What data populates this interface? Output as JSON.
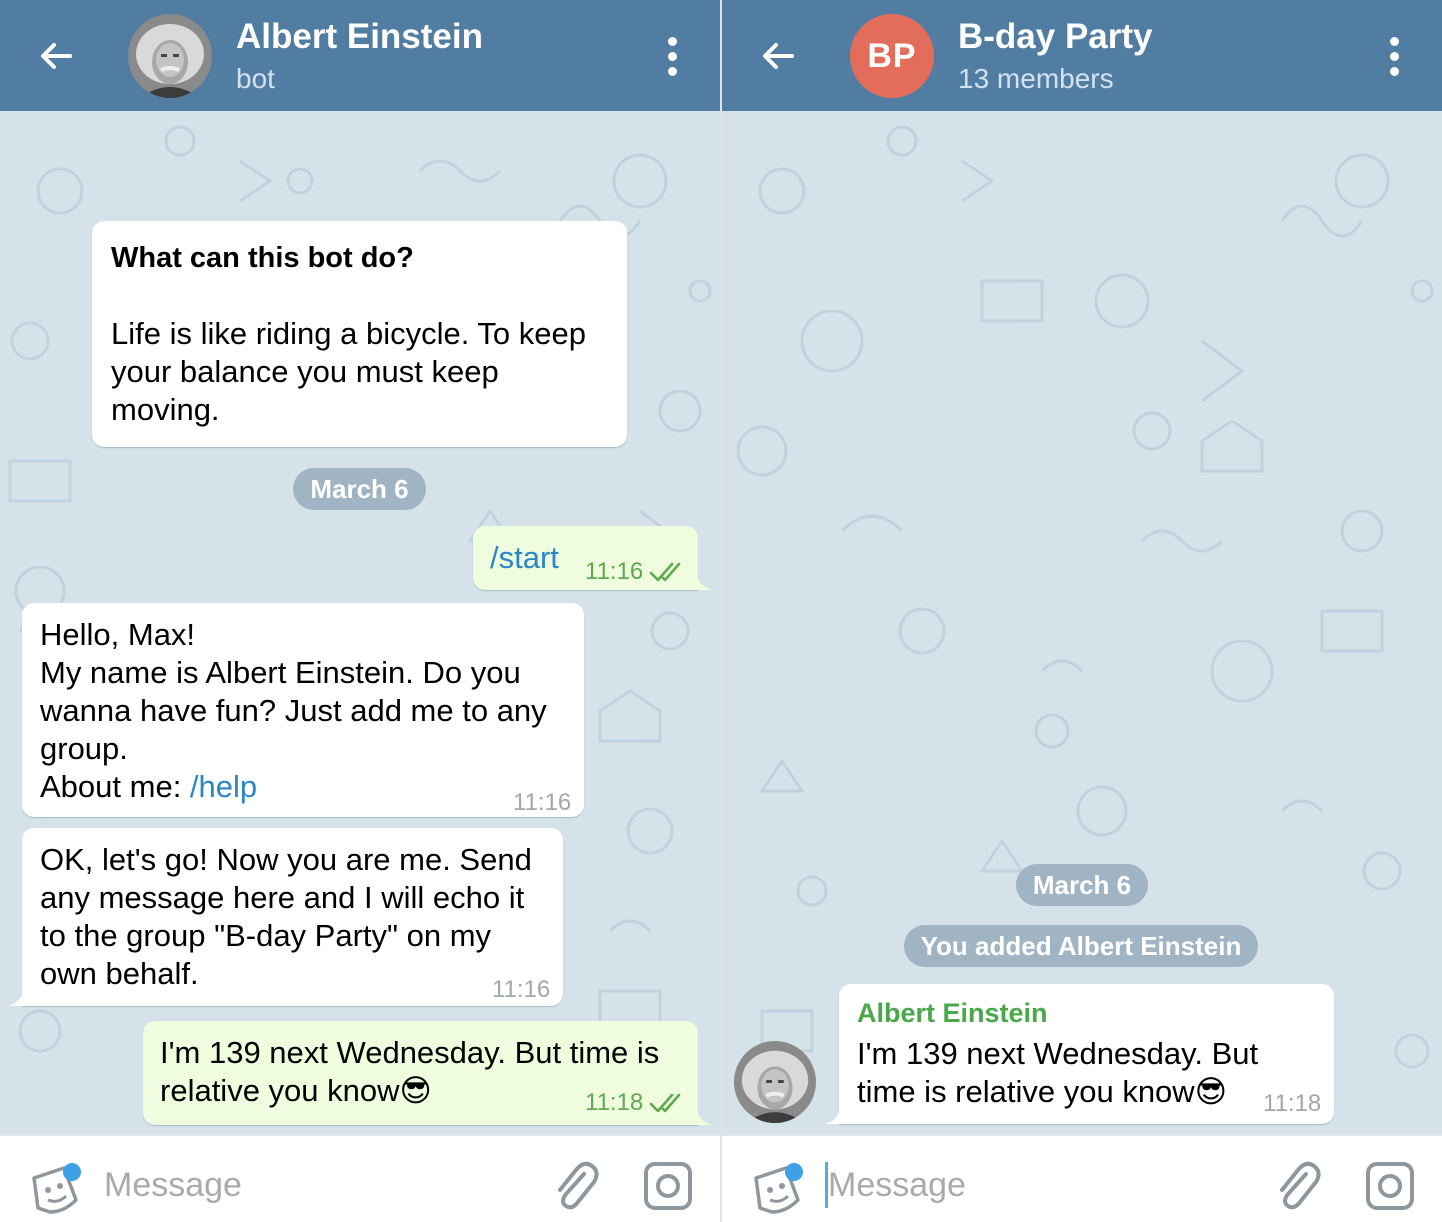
{
  "left": {
    "header": {
      "title": "Albert Einstein",
      "subtitle": "bot"
    },
    "bot_info": {
      "heading": "What can this bot do?",
      "body": "Life is like riding a bicycle. To keep\nyour balance you must keep\nmoving."
    },
    "date_pill": "March 6",
    "messages": [
      {
        "direction": "out",
        "text": "/start",
        "time": "11:16",
        "status": "read"
      },
      {
        "direction": "in",
        "text": "Hello, Max!\nMy name is Albert Einstein. Do you\nwanna have fun? Just add me to any\ngroup.",
        "extra_label": "About me: ",
        "extra_link": "/help",
        "time": "11:16"
      },
      {
        "direction": "in",
        "text": "OK, let's go! Now you are me. Send\nany message here and I will echo it\nto the group \"B-day Party\" on my\nown behalf.",
        "time": "11:16"
      },
      {
        "direction": "out",
        "text": "I'm 139 next Wednesday. But time is\nrelative you know",
        "emoji": "😎",
        "time": "11:18",
        "status": "read"
      }
    ],
    "input": {
      "placeholder": "Message"
    }
  },
  "right": {
    "header": {
      "title": "B-day Party",
      "subtitle": "13 members",
      "avatar_initials": "BP",
      "avatar_color": "#e36c5b"
    },
    "date_pill": "March 6",
    "service_message": "You added Albert Einstein",
    "messages": [
      {
        "direction": "in",
        "sender": "Albert Einstein",
        "text": "I'm 139 next Wednesday. But\ntime is relative you know",
        "emoji": "😎",
        "time": "11:18"
      }
    ],
    "input": {
      "placeholder": "Message"
    }
  },
  "colors": {
    "header": "#527da3",
    "chat_bg": "#d6e2ea",
    "outgoing_bubble": "#effdde",
    "link": "#2a86c6",
    "sender_name": "#4aa84a"
  },
  "icons": [
    "back-arrow-icon",
    "more-vertical-icon",
    "sticker-icon",
    "attach-icon",
    "camera-icon",
    "double-check-icon"
  ]
}
